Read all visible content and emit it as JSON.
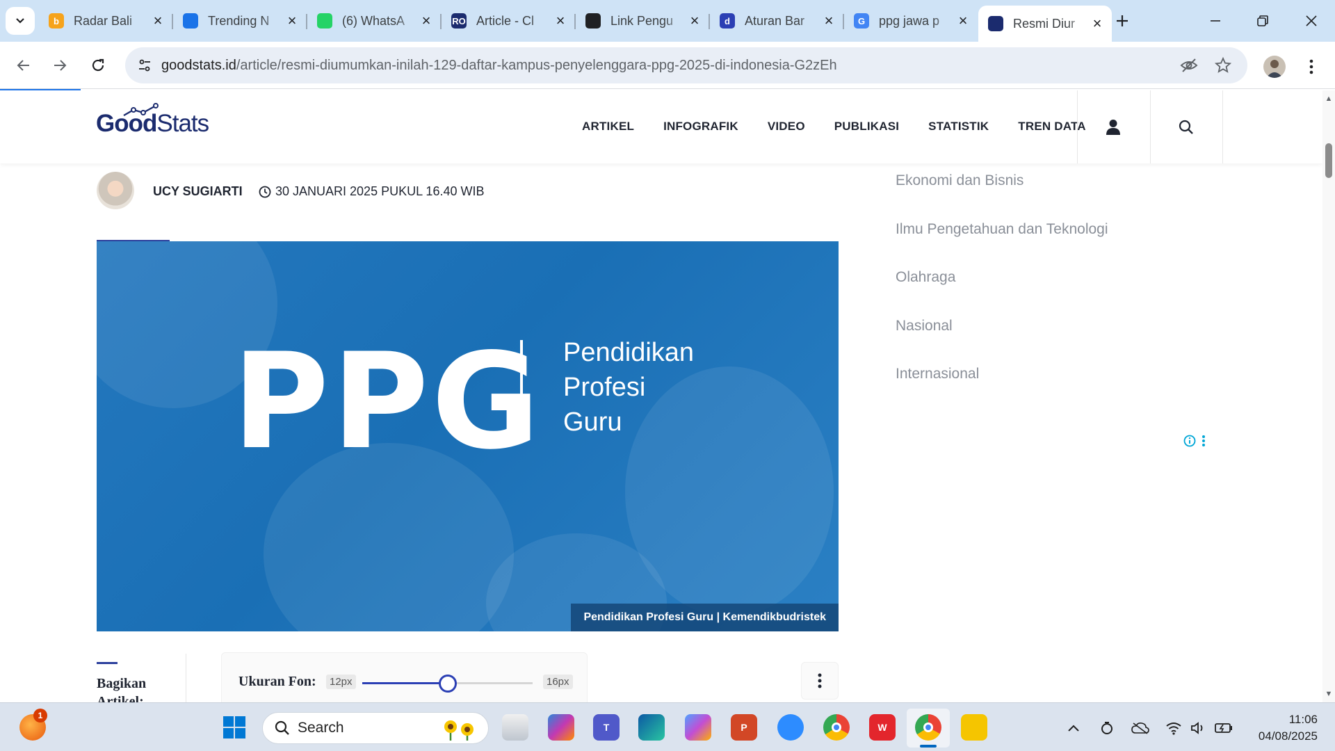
{
  "browser": {
    "tabs": [
      {
        "title": "Radar Bali",
        "favicon_color": "#f6a31b",
        "favicon_text": "b"
      },
      {
        "title": "Trending N",
        "favicon_color": "#1a73e8",
        "favicon_text": ""
      },
      {
        "title": "(6) WhatsA",
        "favicon_color": "#25d366",
        "favicon_text": ""
      },
      {
        "title": "Article - Cl",
        "favicon_color": "#1b2b6e",
        "favicon_text": "RO"
      },
      {
        "title": "Link Pengu",
        "favicon_color": "#202124",
        "favicon_text": ""
      },
      {
        "title": "Aturan Bar",
        "favicon_color": "#2b3fb4",
        "favicon_text": "d"
      },
      {
        "title": "ppg jawa p",
        "favicon_color": "#4285f4",
        "favicon_text": "G"
      },
      {
        "title": "Resmi Diur",
        "favicon_color": "#1b2b6e",
        "favicon_text": ""
      }
    ],
    "active_tab_index": 7,
    "url_host": "goodstats.id",
    "url_path": "/article/resmi-diumumkan-inilah-129-daftar-kampus-penyelenggara-ppg-2025-di-indonesia-G2zEh"
  },
  "site": {
    "logo_good": "Good",
    "logo_stats": "Stats",
    "nav": [
      "ARTIKEL",
      "INFOGRAFIK",
      "VIDEO",
      "PUBLIKASI",
      "STATISTIK",
      "TREN DATA"
    ]
  },
  "article": {
    "author": "UCY SUGIARTI",
    "date": "30 JANUARI 2025 PUKUL 16.40 WIB",
    "hero": {
      "big_text": "PPG",
      "full_line1": "Pendidikan",
      "full_line2": "Profesi",
      "full_line3": "Guru",
      "caption": "Pendidikan Profesi Guru | Kemendikbudristek"
    },
    "share_label": "Bagikan Artikel:",
    "font_size": {
      "label": "Ukuran Fon:",
      "min": "12px",
      "max": "16px",
      "value_fraction": 0.5
    }
  },
  "sidebar": {
    "categories": [
      "Ekonomi dan Bisnis",
      "Ilmu Pengetahuan dan Teknologi",
      "Olahraga",
      "Nasional",
      "Internasional"
    ]
  },
  "taskbar": {
    "search_placeholder": "Search",
    "time": "11:06",
    "date": "04/08/2025",
    "notification_count": "1"
  },
  "colors": {
    "brand_navy": "#1b2b6e",
    "accent_blue": "#2b3fb4",
    "hero_blue": "#1a6fb5"
  }
}
